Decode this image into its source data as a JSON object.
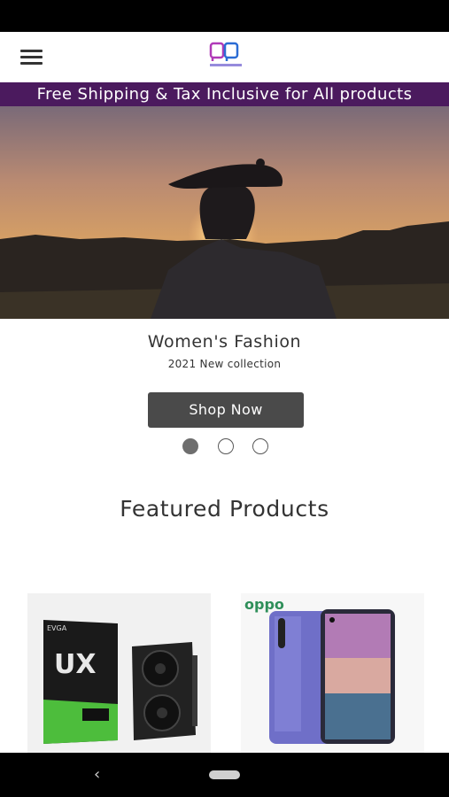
{
  "header": {
    "menu_icon": "hamburger-menu-icon",
    "logo_icon": "store-logo-icon"
  },
  "promo": {
    "text": "Free Shipping & Tax Inclusive for All products"
  },
  "hero": {
    "title": "Women's Fashion",
    "subtitle": "2021 New collection",
    "cta_label": "Shop Now",
    "slide_count": 3,
    "active_slide": 1
  },
  "featured": {
    "title": "Featured Products",
    "products": [
      {
        "image": "graphics-card-image",
        "brand_text": "EVGA"
      },
      {
        "image": "smartphone-image",
        "brand_text": "oppo"
      }
    ]
  },
  "system_nav": {
    "back_icon": "back-chevron-icon",
    "home_icon": "home-pill-icon"
  },
  "colors": {
    "promo_bg": "#4b1a5e",
    "button_bg": "#4a4a4a",
    "logo_accent": "#b03ab8"
  }
}
